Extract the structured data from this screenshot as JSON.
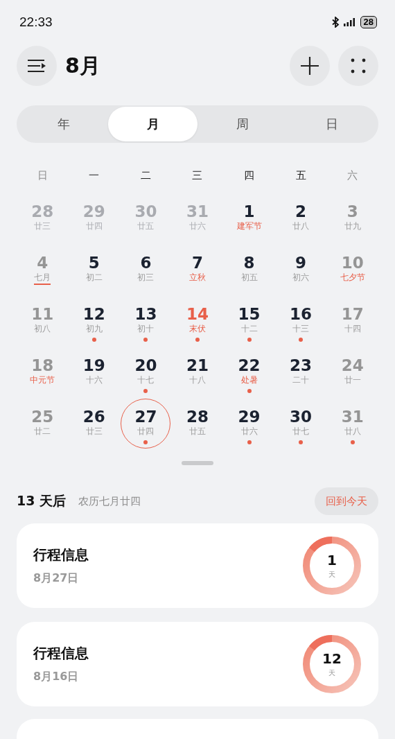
{
  "status_bar": {
    "time": "22:33",
    "battery": "28"
  },
  "header": {
    "title": "8月"
  },
  "tabs": [
    {
      "label": "年",
      "selected": false
    },
    {
      "label": "月",
      "selected": true
    },
    {
      "label": "周",
      "selected": false
    },
    {
      "label": "日",
      "selected": false
    }
  ],
  "weekdays": [
    {
      "label": "日",
      "weekend": true
    },
    {
      "label": "一",
      "weekend": false
    },
    {
      "label": "二",
      "weekend": false
    },
    {
      "label": "三",
      "weekend": false
    },
    {
      "label": "四",
      "weekend": false
    },
    {
      "label": "五",
      "weekend": false
    },
    {
      "label": "六",
      "weekend": true
    }
  ],
  "days": [
    {
      "day": "28",
      "lunar": "廿三",
      "kind": "outside",
      "festival": false,
      "event": false,
      "month_start": false,
      "selected": false
    },
    {
      "day": "29",
      "lunar": "廿四",
      "kind": "outside",
      "festival": false,
      "event": false,
      "month_start": false,
      "selected": false
    },
    {
      "day": "30",
      "lunar": "廿五",
      "kind": "outside",
      "festival": false,
      "event": false,
      "month_start": false,
      "selected": false
    },
    {
      "day": "31",
      "lunar": "廿六",
      "kind": "outside",
      "festival": false,
      "event": false,
      "month_start": false,
      "selected": false
    },
    {
      "day": "1",
      "lunar": "建军节",
      "kind": "weekday",
      "festival": true,
      "event": false,
      "month_start": false,
      "selected": false
    },
    {
      "day": "2",
      "lunar": "廿八",
      "kind": "weekday",
      "festival": false,
      "event": false,
      "month_start": false,
      "selected": false
    },
    {
      "day": "3",
      "lunar": "廿九",
      "kind": "weekend",
      "festival": false,
      "event": false,
      "month_start": false,
      "selected": false
    },
    {
      "day": "4",
      "lunar": "七月",
      "kind": "weekend",
      "festival": false,
      "event": false,
      "month_start": true,
      "selected": false
    },
    {
      "day": "5",
      "lunar": "初二",
      "kind": "weekday",
      "festival": false,
      "event": false,
      "month_start": false,
      "selected": false
    },
    {
      "day": "6",
      "lunar": "初三",
      "kind": "weekday",
      "festival": false,
      "event": false,
      "month_start": false,
      "selected": false
    },
    {
      "day": "7",
      "lunar": "立秋",
      "kind": "weekday",
      "festival": true,
      "event": false,
      "month_start": false,
      "selected": false
    },
    {
      "day": "8",
      "lunar": "初五",
      "kind": "weekday",
      "festival": false,
      "event": false,
      "month_start": false,
      "selected": false
    },
    {
      "day": "9",
      "lunar": "初六",
      "kind": "weekday",
      "festival": false,
      "event": false,
      "month_start": false,
      "selected": false
    },
    {
      "day": "10",
      "lunar": "七夕节",
      "kind": "weekend",
      "festival": true,
      "event": false,
      "month_start": false,
      "selected": false
    },
    {
      "day": "11",
      "lunar": "初八",
      "kind": "weekend",
      "festival": false,
      "event": false,
      "month_start": false,
      "selected": false
    },
    {
      "day": "12",
      "lunar": "初九",
      "kind": "weekday",
      "festival": false,
      "event": true,
      "month_start": false,
      "selected": false
    },
    {
      "day": "13",
      "lunar": "初十",
      "kind": "weekday",
      "festival": false,
      "event": true,
      "month_start": false,
      "selected": false
    },
    {
      "day": "14",
      "lunar": "末伏",
      "kind": "holiday",
      "festival": true,
      "event": true,
      "month_start": false,
      "selected": false
    },
    {
      "day": "15",
      "lunar": "十二",
      "kind": "weekday",
      "festival": false,
      "event": true,
      "month_start": false,
      "selected": false
    },
    {
      "day": "16",
      "lunar": "十三",
      "kind": "weekday",
      "festival": false,
      "event": true,
      "month_start": false,
      "selected": false
    },
    {
      "day": "17",
      "lunar": "十四",
      "kind": "weekend",
      "festival": false,
      "event": false,
      "month_start": false,
      "selected": false
    },
    {
      "day": "18",
      "lunar": "中元节",
      "kind": "weekend",
      "festival": true,
      "event": false,
      "month_start": false,
      "selected": false
    },
    {
      "day": "19",
      "lunar": "十六",
      "kind": "weekday",
      "festival": false,
      "event": false,
      "month_start": false,
      "selected": false
    },
    {
      "day": "20",
      "lunar": "十七",
      "kind": "weekday",
      "festival": false,
      "event": true,
      "month_start": false,
      "selected": false
    },
    {
      "day": "21",
      "lunar": "十八",
      "kind": "weekday",
      "festival": false,
      "event": false,
      "month_start": false,
      "selected": false
    },
    {
      "day": "22",
      "lunar": "处暑",
      "kind": "weekday",
      "festival": true,
      "event": true,
      "month_start": false,
      "selected": false
    },
    {
      "day": "23",
      "lunar": "二十",
      "kind": "weekday",
      "festival": false,
      "event": false,
      "month_start": false,
      "selected": false
    },
    {
      "day": "24",
      "lunar": "廿一",
      "kind": "weekend",
      "festival": false,
      "event": false,
      "month_start": false,
      "selected": false
    },
    {
      "day": "25",
      "lunar": "廿二",
      "kind": "weekend",
      "festival": false,
      "event": false,
      "month_start": false,
      "selected": false
    },
    {
      "day": "26",
      "lunar": "廿三",
      "kind": "weekday",
      "festival": false,
      "event": false,
      "month_start": false,
      "selected": false
    },
    {
      "day": "27",
      "lunar": "廿四",
      "kind": "weekday",
      "festival": false,
      "event": true,
      "month_start": false,
      "selected": true
    },
    {
      "day": "28",
      "lunar": "廿五",
      "kind": "weekday",
      "festival": false,
      "event": false,
      "month_start": false,
      "selected": false
    },
    {
      "day": "29",
      "lunar": "廿六",
      "kind": "weekday",
      "festival": false,
      "event": true,
      "month_start": false,
      "selected": false
    },
    {
      "day": "30",
      "lunar": "廿七",
      "kind": "weekday",
      "festival": false,
      "event": true,
      "month_start": false,
      "selected": false
    },
    {
      "day": "31",
      "lunar": "廿八",
      "kind": "weekend",
      "festival": false,
      "event": true,
      "month_start": false,
      "selected": false
    }
  ],
  "summary": {
    "countdown": "13 天后",
    "lunar_date": "农历七月廿四",
    "today_button": "回到今天"
  },
  "events": [
    {
      "title": "行程信息",
      "date": "8月27日",
      "days": "1",
      "unit": "天"
    },
    {
      "title": "行程信息",
      "date": "8月16日",
      "days": "12",
      "unit": "天"
    }
  ]
}
